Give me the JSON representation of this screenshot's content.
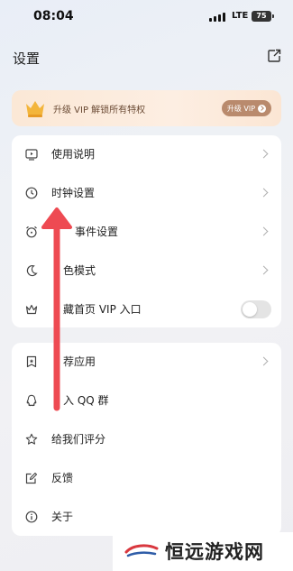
{
  "status_bar": {
    "time": "08:04",
    "network": "LTE",
    "battery": "75"
  },
  "header": {
    "title": "设置"
  },
  "vip_banner": {
    "text": "升级 VIP 解锁所有特权",
    "button_label": "升级 VIP"
  },
  "settings_group_1": [
    {
      "label": "使用说明",
      "icon": "tv-icon",
      "control": "chevron"
    },
    {
      "label": "时钟设置",
      "icon": "clock-icon",
      "control": "chevron"
    },
    {
      "label": "事件设置",
      "icon": "alarm-icon",
      "control": "chevron"
    },
    {
      "label": "色模式",
      "icon": "moon-icon",
      "control": "chevron"
    },
    {
      "label": "藏首页 VIP 入口",
      "icon": "crown-icon",
      "control": "toggle",
      "toggle_on": false
    }
  ],
  "settings_group_2": [
    {
      "label": "荐应用",
      "icon": "bookmark-icon",
      "control": "chevron"
    },
    {
      "label": "入 QQ 群",
      "icon": "qq-icon",
      "control": "none"
    },
    {
      "label": "给我们评分",
      "icon": "star-icon",
      "control": "none"
    },
    {
      "label": "反馈",
      "icon": "edit-icon",
      "control": "none"
    },
    {
      "label": "关于",
      "icon": "info-icon",
      "control": "none"
    }
  ],
  "watermark": {
    "text": "恒远游戏网"
  },
  "colors": {
    "accent_arrow": "#ee4a52",
    "vip_button": "#b98a6d",
    "banner": "#fbe8d6"
  }
}
